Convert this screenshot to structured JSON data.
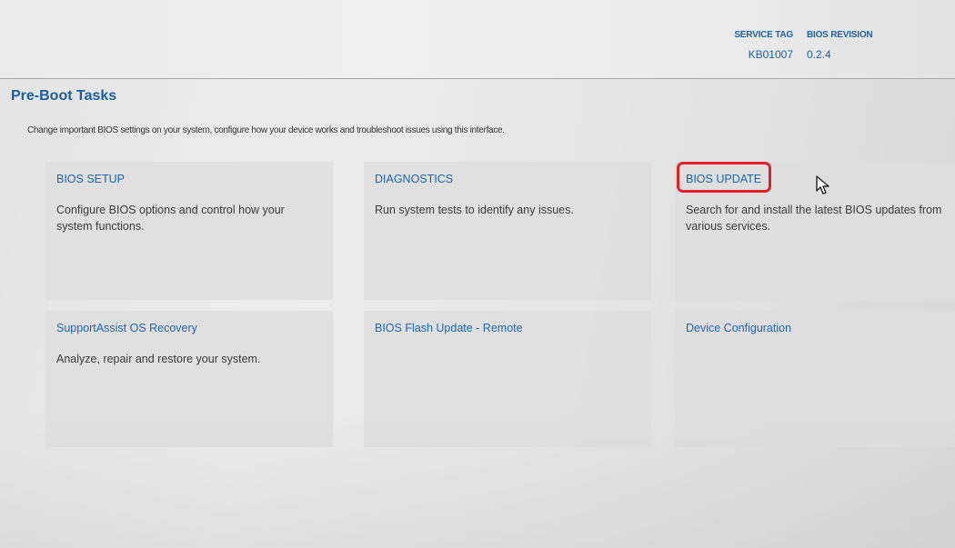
{
  "header": {
    "service_tag_label": "SERVICE TAG",
    "service_tag_value": "KB01007",
    "bios_revision_label": "BIOS REVISION",
    "bios_revision_value": "0.2.4"
  },
  "page": {
    "title": "Pre-Boot Tasks",
    "description": "Change important BIOS settings on your system, configure how your device works and troubleshoot issues using this interface."
  },
  "tiles": [
    {
      "title": "BIOS SETUP",
      "description": "Configure BIOS options and control how your system functions."
    },
    {
      "title": "DIAGNOSTICS",
      "description": "Run system tests to identify any issues."
    },
    {
      "title": "BIOS UPDATE",
      "description": "Search for and install the latest BIOS updates from various services."
    },
    {
      "title": "SupportAssist OS Recovery",
      "description": "Analyze, repair and restore your system."
    },
    {
      "title": "BIOS Flash Update - Remote",
      "description": ""
    },
    {
      "title": "Device Configuration",
      "description": ""
    }
  ],
  "colors": {
    "accent": "#1d65ad",
    "highlight": "#e51f2b"
  },
  "icons": {
    "cursor": "mouse-pointer-icon"
  }
}
